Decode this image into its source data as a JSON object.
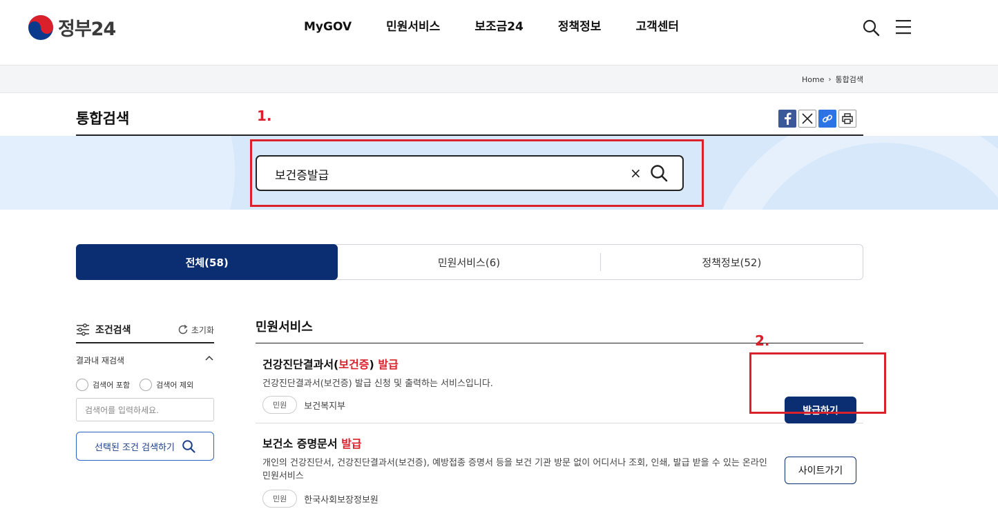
{
  "header": {
    "logo_text": "정부24",
    "nav": [
      "MyGOV",
      "민원서비스",
      "보조금24",
      "정책정보",
      "고객센터"
    ]
  },
  "breadcrumb": {
    "home": "Home",
    "current": "통합검색"
  },
  "page": {
    "title": "통합검색"
  },
  "annotations": {
    "label1": "1.",
    "label2": "2.",
    "color": "#d9202b"
  },
  "search": {
    "value": "보건증발급",
    "clear": "×"
  },
  "tabs": [
    {
      "label": "전체(58)",
      "active": true
    },
    {
      "label": "민원서비스(6)",
      "active": false
    },
    {
      "label": "정책정보(52)",
      "active": false
    }
  ],
  "sidebar": {
    "title": "조건검색",
    "reset": "초기화",
    "refine_title": "결과내 재검색",
    "radio_include": "검색어 포함",
    "radio_exclude": "검색어 제외",
    "input_placeholder": "검색어를 입력하세요.",
    "search_button": "선택된 조건 검색하기"
  },
  "results": {
    "section_title": "민원서비스",
    "items": [
      {
        "title": "건강진단결과서(",
        "title_hl1": "보건증",
        "title_mid": ") ",
        "title_hl2": "발급",
        "desc": "건강진단결과서(보건증) 발급 신청 및 출력하는 서비스입니다.",
        "tag": "민원",
        "agency": "보건복지부",
        "button": "발급하기"
      },
      {
        "title": "보건소 증명문서 ",
        "title_hl": "발급",
        "desc": "개인의 건강진단서, 건강진단결과서(보건증), 예방접종 증명서 등을 보건 기관 방문 없이 어디서나 조회, 인쇄, 발급 받을 수 있는 온라인 민원서비스",
        "tag": "민원",
        "agency": "한국사회보장정보원",
        "button": "사이트가기"
      }
    ]
  },
  "colors": {
    "primary": "#0b2e73",
    "accent_red": "#d9202b",
    "band": "#d7e8fb"
  }
}
